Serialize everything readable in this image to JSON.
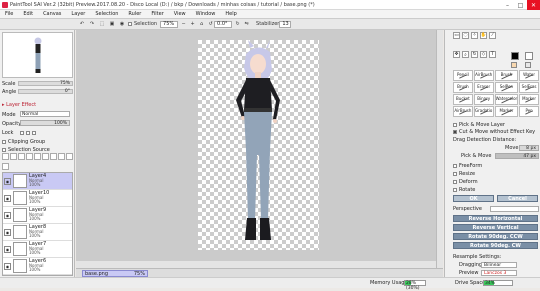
{
  "window": {
    "title": "PaintTool SAI Ver.2 (32bit) Preview.2017.08.20 - Disco Local (D:) / bkp / Downloads / minhas coisas / tutorial / base.png (*)",
    "minimize": "–",
    "maximize": "□",
    "close": "✕"
  },
  "menu": [
    "File",
    "Edit",
    "Canvas",
    "Layer",
    "Selection",
    "Ruler",
    "Filter",
    "View",
    "Window",
    "Help"
  ],
  "toolbar": {
    "selection_label": "Selection",
    "zoom": "75%",
    "angle": "0.0°",
    "stabilizer_label": "Stabilizer",
    "stabilizer_value": "13"
  },
  "navigator": {
    "scale_label": "Scale",
    "scale_value": "75%",
    "angle_label": "Angle",
    "angle_value": "0°"
  },
  "layer_props": {
    "effect_label": "Layer Effect",
    "mode_label": "Mode",
    "mode_value": "Normal",
    "opacity_label": "Opacity",
    "opacity_value": "100%",
    "lock_label": "Lock",
    "clipping_label": "Clipping Group",
    "selection_source_label": "Selection Source"
  },
  "layers": [
    {
      "name": "Layer4",
      "mode": "Normal",
      "opacity": "100%",
      "selected": true
    },
    {
      "name": "Layer10",
      "mode": "Normal",
      "opacity": "100%",
      "selected": false
    },
    {
      "name": "Layer9",
      "mode": "Normal",
      "opacity": "100%",
      "selected": false
    },
    {
      "name": "Layer8",
      "mode": "Normal",
      "opacity": "100%",
      "selected": false
    },
    {
      "name": "Layer7",
      "mode": "Normal",
      "opacity": "100%",
      "selected": false
    },
    {
      "name": "Layer6",
      "mode": "Normal",
      "opacity": "100%",
      "selected": false
    }
  ],
  "document_tab": {
    "name": "base.png",
    "zoom": "75%"
  },
  "status": {
    "memory_label": "Memory Usage",
    "memory_value": "28% (30%)",
    "memory_fraction": 0.28,
    "drive_label": "Drive Space",
    "drive_value": "34%",
    "drive_fraction": 0.34
  },
  "brushes": [
    "Pencil",
    "AirBrush",
    "Brush",
    "Water",
    "Brush",
    "Eraser",
    "SelPen",
    "SelEras",
    "Bucket",
    "Binary",
    "Watercolor",
    "Marker",
    "AirBrush",
    "Gradatio",
    "Marker",
    "Pen"
  ],
  "options": {
    "pick_move_layer": "Pick & Move Layer",
    "cut_move": "Cut & Move without Effect Key",
    "drag_detect": "Drag Detection Distance:",
    "move_label": "Move",
    "move_value": "8 px",
    "pick_move_label": "Pick & Move",
    "pick_move_value": "47 px",
    "freeform": "FreeForm",
    "resize": "Resize",
    "deform": "Deform",
    "rotate": "Rotate",
    "ok": "OK",
    "cancel": "Cancel",
    "perspective_label": "Perspective",
    "reverse_h": "Reverse Horizontal",
    "reverse_v": "Reverse Vertical",
    "rotate_ccw": "Rotate 90deg. CCW",
    "rotate_cw": "Rotate 90deg. CW",
    "resample_label": "Resample Settings:",
    "dragging_label": "Dragging",
    "dragging_value": "Bilinear",
    "preview_label": "Preview",
    "preview_value": "Lanczos 3"
  },
  "colors": {
    "accent_selection": "#c9c9f4",
    "button": "#7a8fa6",
    "progress": "#3bc85c",
    "fg_color": "#000000",
    "bg_color": "#ffffff"
  }
}
